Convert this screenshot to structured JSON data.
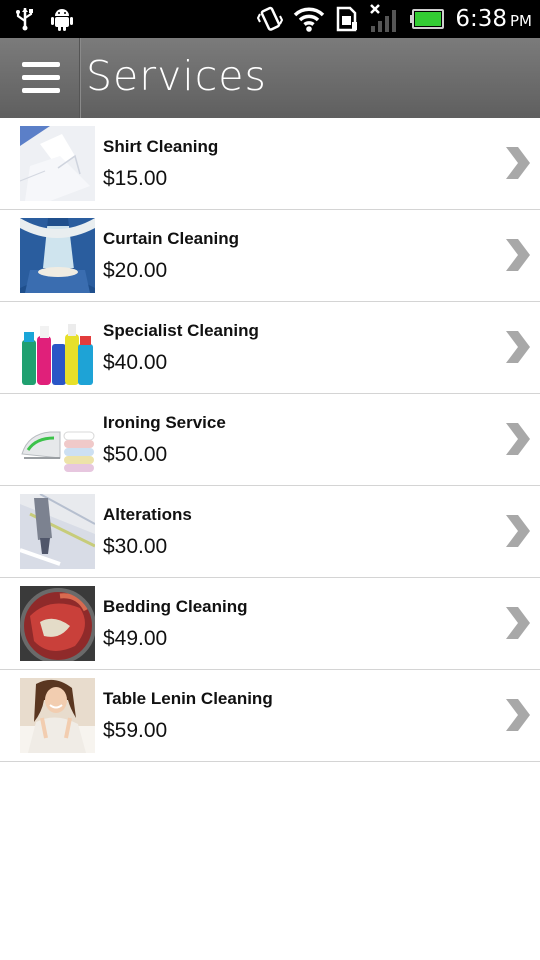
{
  "status_bar": {
    "time": "6:38",
    "ampm": "PM",
    "icons": [
      "usb-icon",
      "android-debug-icon",
      "vibrate-icon",
      "wifi-icon",
      "sim-card-icon",
      "no-signal-icon",
      "battery-icon"
    ]
  },
  "header": {
    "title": "Services",
    "menu_icon": "hamburger-menu-icon"
  },
  "services": [
    {
      "name": "Shirt Cleaning",
      "price": "$15.00",
      "image": "white-shirt"
    },
    {
      "name": "Curtain Cleaning",
      "price": "$20.00",
      "image": "curtained-bedroom"
    },
    {
      "name": "Specialist Cleaning",
      "price": "$40.00",
      "image": "cleaning-bottles"
    },
    {
      "name": "Ironing Service",
      "price": "$50.00",
      "image": "iron-and-towels"
    },
    {
      "name": "Alterations",
      "price": "$30.00",
      "image": "sewing-machine"
    },
    {
      "name": "Bedding Cleaning",
      "price": "$49.00",
      "image": "washing-machine-drum"
    },
    {
      "name": "Table Lenin Cleaning",
      "price": "$59.00",
      "image": "smiling-woman"
    }
  ],
  "colors": {
    "action_bar": "#6b6b6b",
    "status_bar": "#000000",
    "chevron": "#a8a8a8",
    "divider": "#d4d4d4"
  }
}
